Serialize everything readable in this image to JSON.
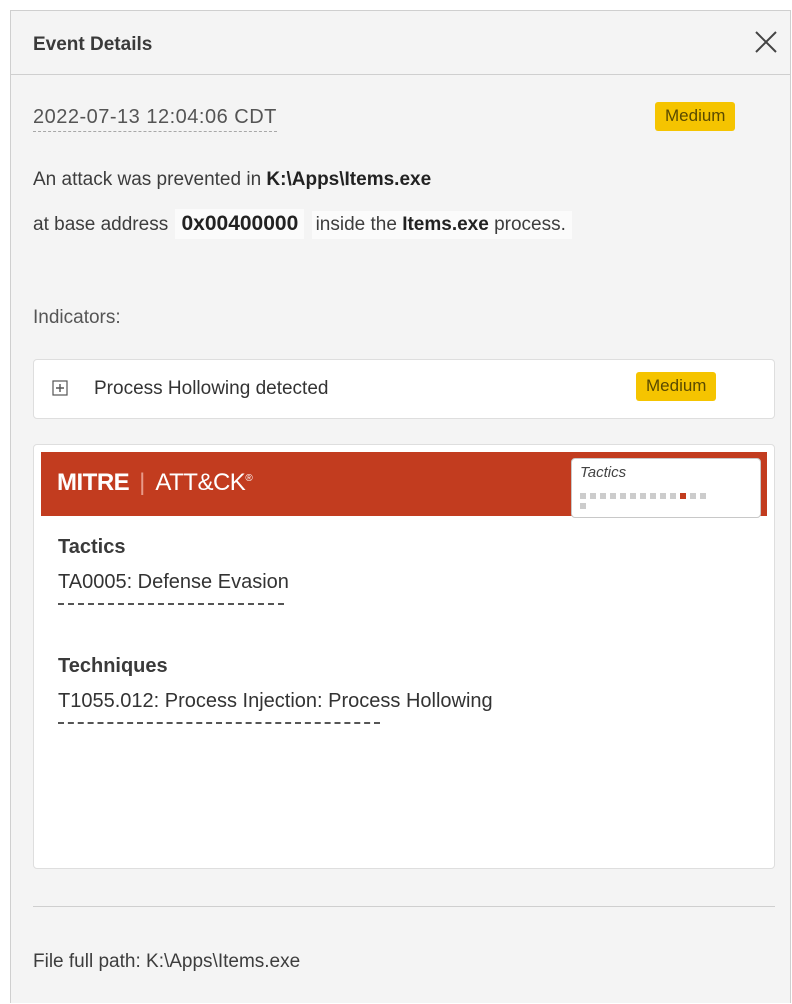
{
  "header": {
    "title": "Event Details",
    "close_icon": "close-icon"
  },
  "event": {
    "timestamp": "2022-07-13 12:04:06 CDT",
    "severity": "Medium",
    "description_line1_prefix": "An attack was prevented in",
    "description_line1_path": "K:\\Apps\\Items.exe",
    "description_line2_prefix": "at base address",
    "base_address": "0x00400000",
    "description_line2_mid": "inside the",
    "process_name": "Items.exe",
    "description_line2_suffix": "process."
  },
  "indicators": {
    "label": "Indicators:",
    "items": [
      {
        "text": "Process Hollowing detected",
        "severity": "Medium",
        "icon": "expand-plus-icon"
      }
    ]
  },
  "mitre": {
    "logo_mitre": "MITRE",
    "logo_separator": "|",
    "logo_attck": "ATT&CK",
    "logo_mark": "®",
    "mini_label": "Tactics",
    "mini_highlight_index": 10,
    "tactics_heading": "Tactics",
    "tactic": "TA0005: Defense Evasion",
    "techniques_heading": "Techniques",
    "technique": "T1055.012: Process Injection: Process Hollowing"
  },
  "footer": {
    "file_path_label": "File full path:",
    "file_path_value": "K:\\Apps\\Items.exe"
  },
  "colors": {
    "severity_badge": "#f5c400",
    "mitre_banner": "#c23c1f",
    "mini_highlight": "#c23c1f",
    "mini_square": "#cccccc"
  }
}
